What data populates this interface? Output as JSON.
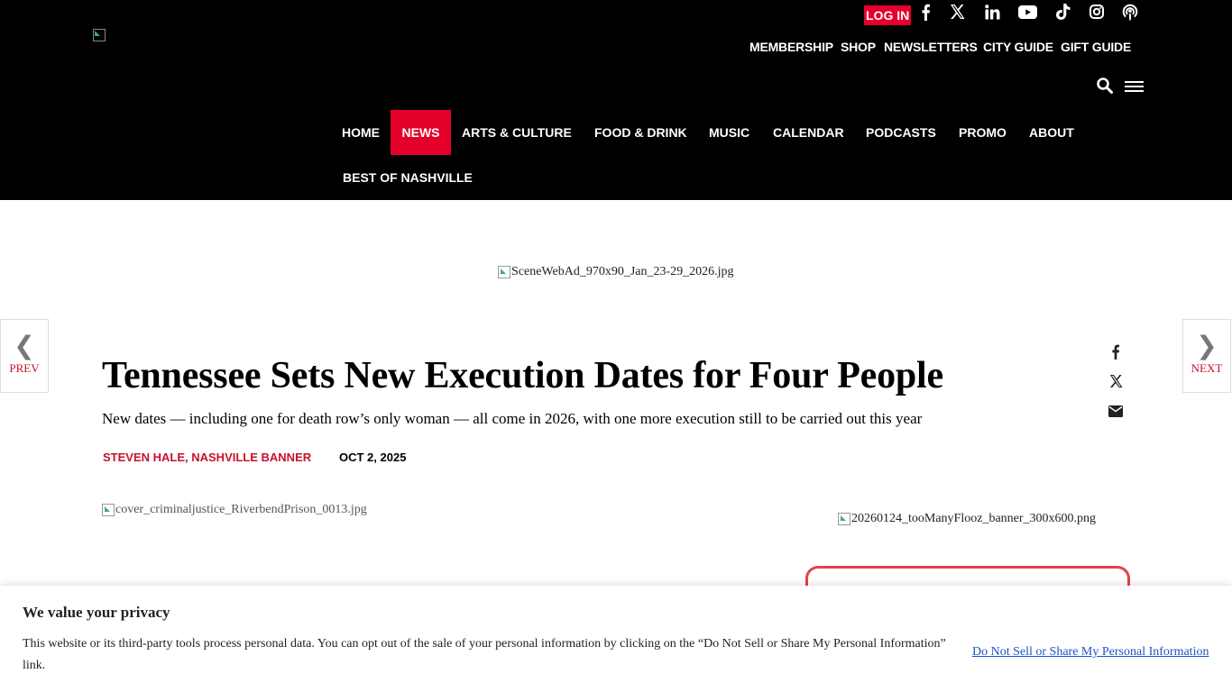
{
  "header": {
    "login_label": "LOG IN",
    "utility_links": [
      "MEMBERSHIP",
      "SHOP",
      "NEWSLETTERS",
      "CITY GUIDE",
      "GIFT GUIDE"
    ],
    "social_icons": [
      "facebook-icon",
      "x-icon",
      "linkedin-icon",
      "youtube-icon",
      "tiktok-icon",
      "instagram-icon",
      "podcast-icon"
    ],
    "nav": [
      "HOME",
      "NEWS",
      "ARTS & CULTURE",
      "FOOD & DRINK",
      "MUSIC",
      "CALENDAR",
      "PODCASTS",
      "PROMO",
      "ABOUT",
      "BEST OF NASHVILLE"
    ],
    "active_nav": "NEWS",
    "accent_color": "#e4002b"
  },
  "ads": {
    "top_banner": "SceneWebAd_970x90_Jan_23-29_2026.jpg",
    "side_banner": "20260124_tooManyFlooz_banner_300x600.png"
  },
  "pager": {
    "prev_label": "PREV",
    "next_label": "NEXT"
  },
  "article": {
    "title": "Tennessee Sets New Execution Dates for Four People",
    "subtitle": "New dates — including one for death row’s only woman — all come in 2026, with one more execution still to be carried out this year",
    "byline": "STEVEN HALE, NASHVILLE BANNER",
    "date": "OCT 2, 2025",
    "hero_image": "cover_criminaljustice_RiverbendPrison_0013.jpg"
  },
  "share_icons": [
    "facebook-icon",
    "x-icon",
    "email-icon"
  ],
  "consent": {
    "heading": "We value your privacy",
    "body": "This website or its third-party tools process personal data. You can opt out of the sale of your personal information by clicking on the “Do Not Sell or Share My Personal Information” link.",
    "link_label": "Do Not Sell or Share My Personal Information"
  }
}
